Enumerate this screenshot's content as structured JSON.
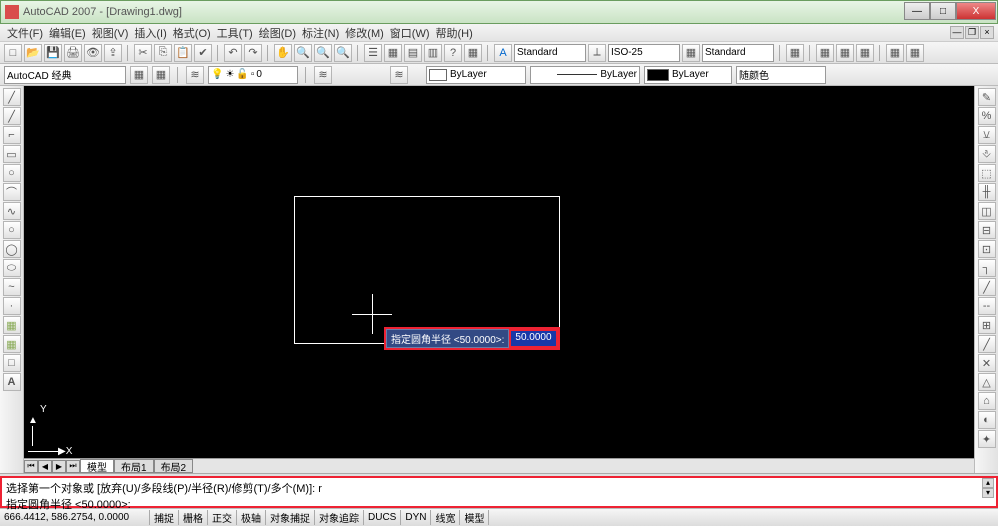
{
  "title": "AutoCAD 2007 - [Drawing1.dwg]",
  "menus": [
    "文件(F)",
    "编辑(E)",
    "视图(V)",
    "插入(I)",
    "格式(O)",
    "工具(T)",
    "绘图(D)",
    "标注(N)",
    "修改(M)",
    "窗口(W)",
    "帮助(H)"
  ],
  "workspace": "AutoCAD 经典",
  "layer_name": "0",
  "style_text": "Standard",
  "style_dim": "ISO-25",
  "style_table": "Standard",
  "prop_color": "ByLayer",
  "prop_ltype": "ByLayer",
  "prop_lweight": "ByLayer",
  "prop_plotstyle": "随颜色",
  "dyn_label": "指定圆角半径 <50.0000>:",
  "dyn_value": "50.0000",
  "cmd_line1": "选择第一个对象或 [放弃(U)/多段线(P)/半径(R)/修剪(T)/多个(M)]: r",
  "cmd_line2": "指定圆角半径 <50.0000>:",
  "tabs": [
    "模型",
    "布局1",
    "布局2"
  ],
  "status_coords": "666.4412, 586.2754, 0.0000",
  "status_toggles": [
    "捕捉",
    "栅格",
    "正交",
    "极轴",
    "对象捕捉",
    "对象追踪",
    "DUCS",
    "DYN",
    "线宽",
    "模型"
  ],
  "ucs": {
    "x": "X",
    "y": "Y"
  },
  "tbicons": {
    "new": "□",
    "open": "📂",
    "save": "💾",
    "print": "🖨",
    "cut": "✂",
    "copy": "⎘",
    "paste": "📋",
    "undo": "↶",
    "redo": "↷",
    "zoom": "🔍",
    "pan": "✋",
    "text": "A"
  },
  "draw_icons": [
    "╱",
    "╱",
    "⌐",
    "▭",
    "○",
    "⌒",
    "∿",
    "○",
    "◯",
    "⬭",
    "~",
    "·",
    "▦",
    "▦",
    "□",
    "A"
  ],
  "mod_icons": [
    "✎",
    "%",
    "⚺",
    "⎀",
    "⬚",
    "╫",
    "◫",
    "⊟",
    "⊡",
    "┐",
    "╱",
    "--",
    "⊞",
    "╱",
    "✕",
    "△",
    "⌂",
    "◐",
    "✦"
  ]
}
